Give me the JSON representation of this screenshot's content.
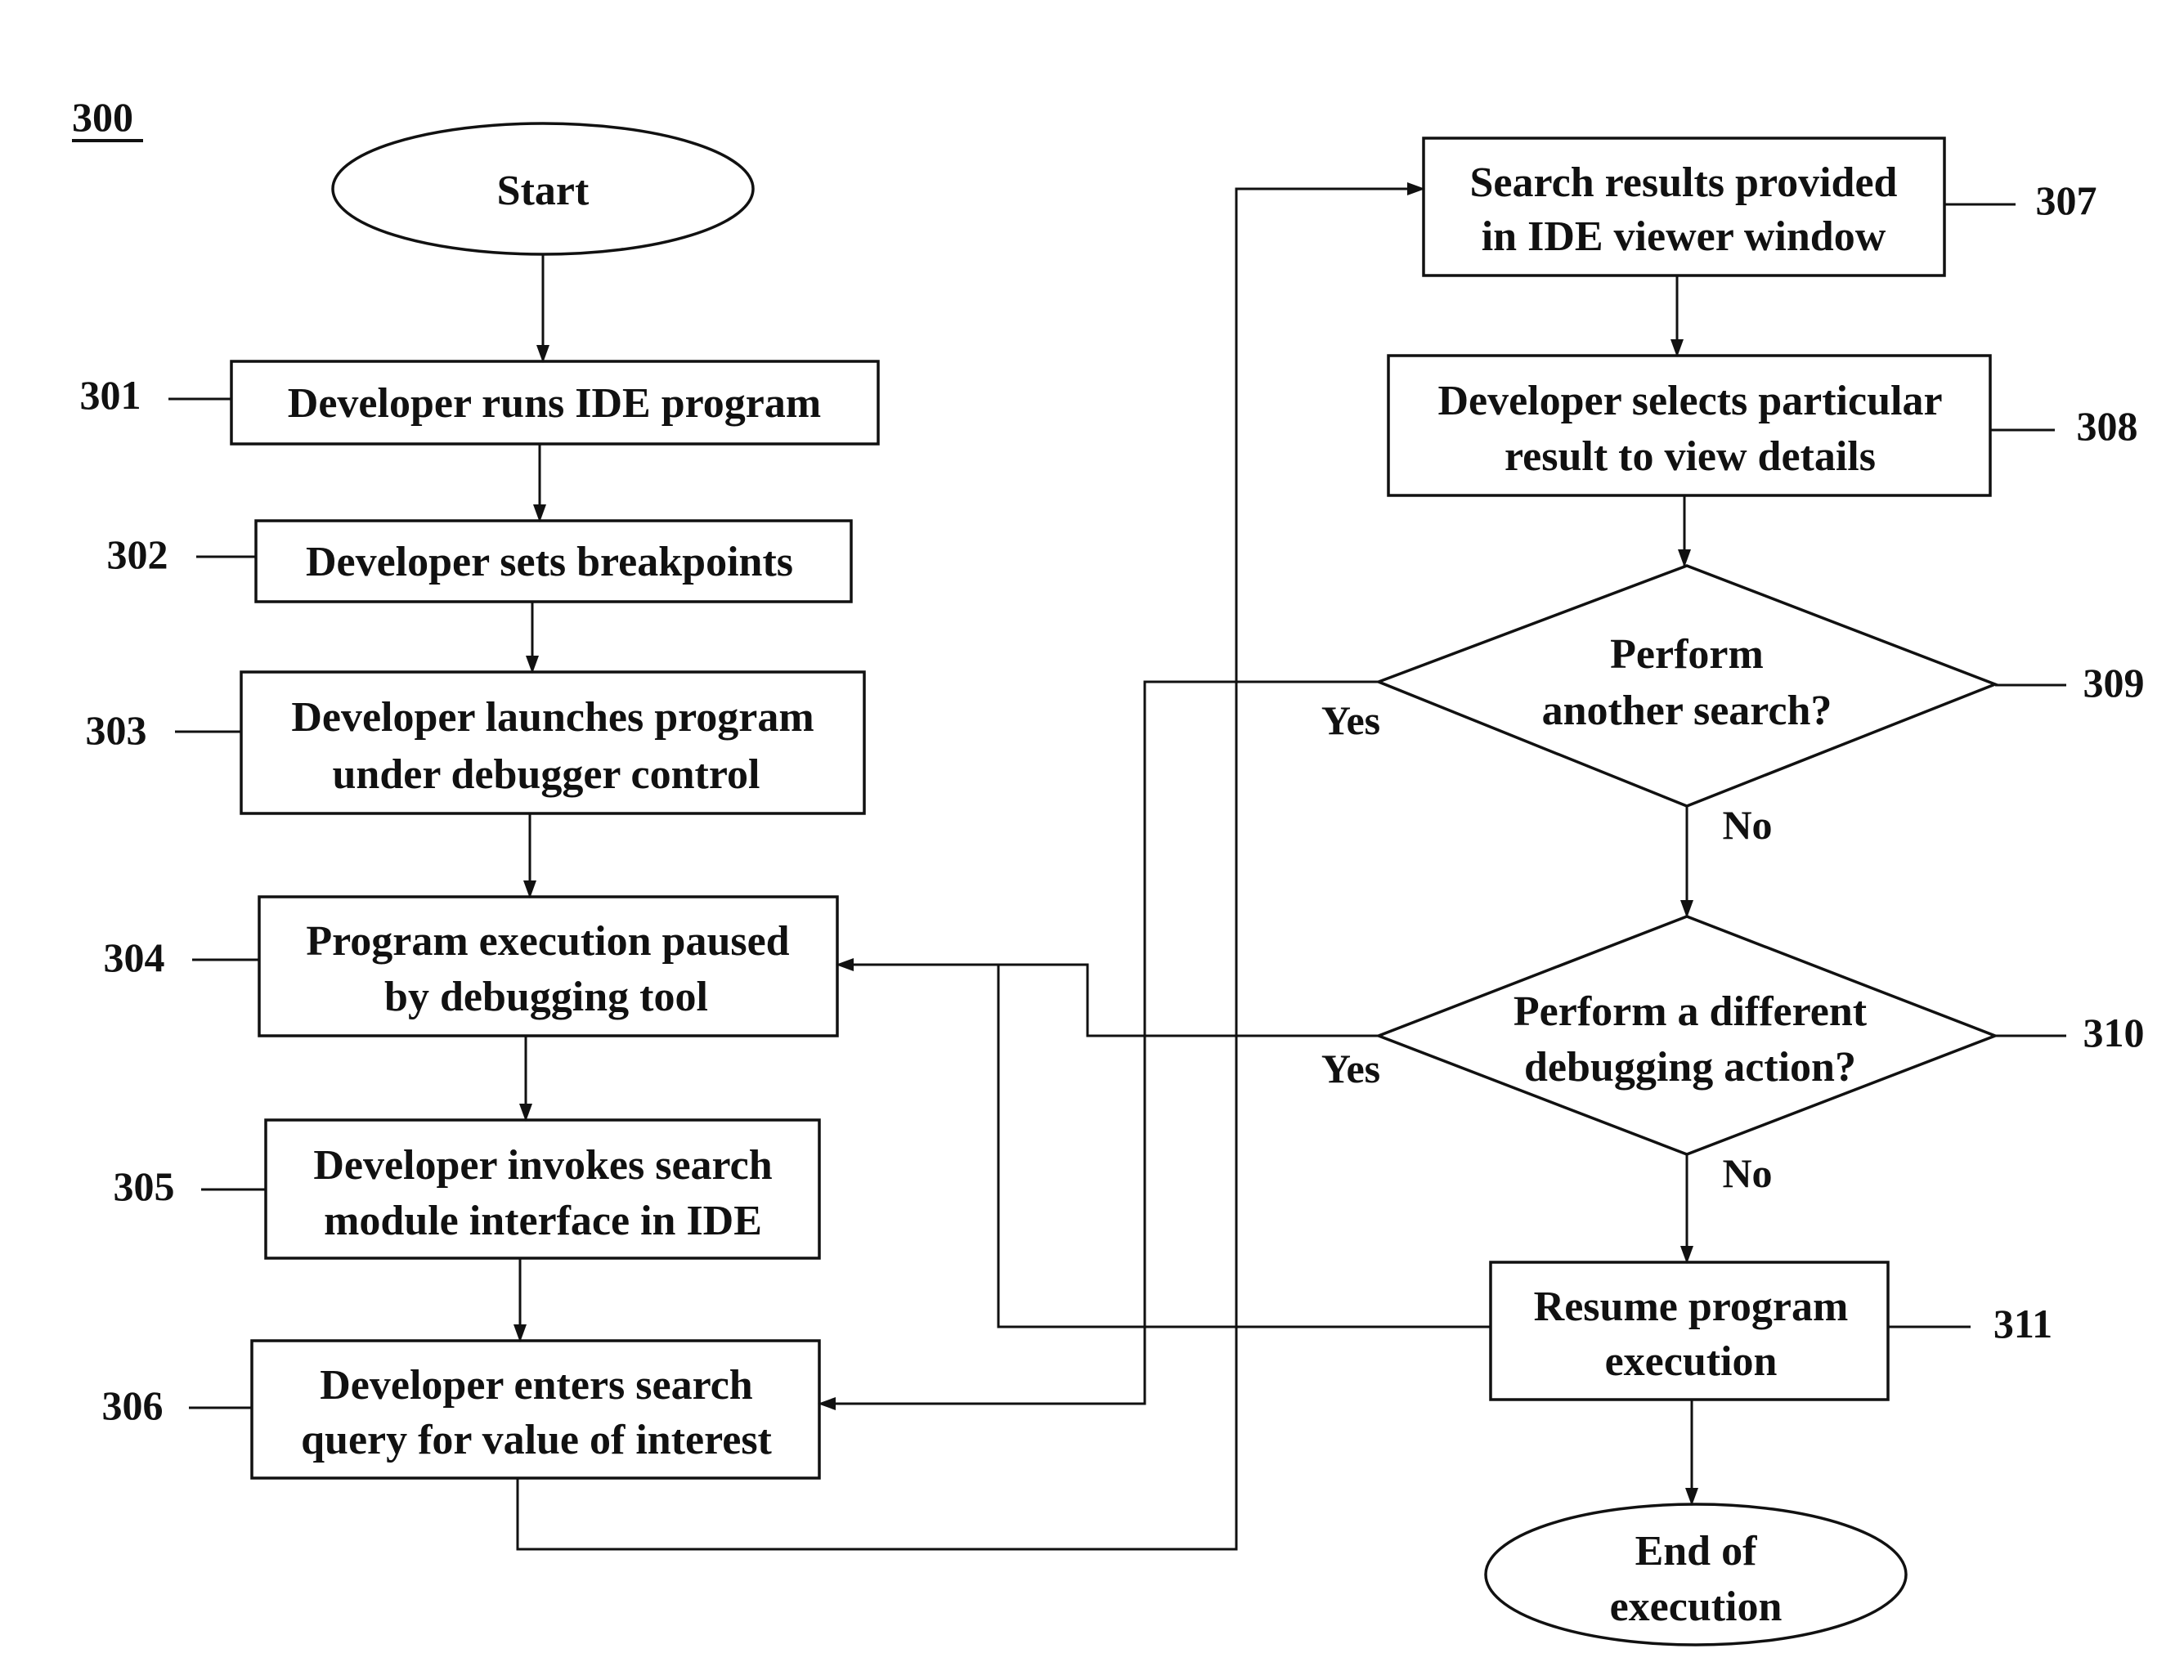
{
  "figure": {
    "number": "300"
  },
  "nodes": {
    "start": {
      "text": [
        "Start"
      ]
    },
    "n301": {
      "ref": "301",
      "text": [
        "Developer runs IDE program"
      ]
    },
    "n302": {
      "ref": "302",
      "text": [
        "Developer sets breakpoints"
      ]
    },
    "n303": {
      "ref": "303",
      "text": [
        "Developer launches program",
        "under debugger control"
      ]
    },
    "n304": {
      "ref": "304",
      "text": [
        "Program execution paused",
        "by debugging tool"
      ]
    },
    "n305": {
      "ref": "305",
      "text": [
        "Developer invokes search",
        "module interface in IDE"
      ]
    },
    "n306": {
      "ref": "306",
      "text": [
        "Developer enters search",
        "query for value of interest"
      ]
    },
    "n307": {
      "ref": "307",
      "text": [
        "Search results provided",
        "in IDE viewer window"
      ]
    },
    "n308": {
      "ref": "308",
      "text": [
        "Developer selects particular",
        "result to view details"
      ]
    },
    "n309": {
      "ref": "309",
      "text": [
        "Perform",
        "another search?"
      ],
      "yes": "Yes",
      "no": "No"
    },
    "n310": {
      "ref": "310",
      "text": [
        "Perform a different",
        "debugging action?"
      ],
      "yes": "Yes",
      "no": "No"
    },
    "n311": {
      "ref": "311",
      "text": [
        "Resume program",
        "execution"
      ]
    },
    "end": {
      "text": [
        "End of",
        "execution"
      ]
    }
  },
  "edges": [
    {
      "from": "start",
      "to": "n301"
    },
    {
      "from": "n301",
      "to": "n302"
    },
    {
      "from": "n302",
      "to": "n303"
    },
    {
      "from": "n303",
      "to": "n304"
    },
    {
      "from": "n304",
      "to": "n305"
    },
    {
      "from": "n305",
      "to": "n306"
    },
    {
      "from": "n306",
      "to": "n307"
    },
    {
      "from": "n307",
      "to": "n308"
    },
    {
      "from": "n308",
      "to": "n309"
    },
    {
      "from": "n309",
      "to": "n306",
      "label": "Yes"
    },
    {
      "from": "n309",
      "to": "n310",
      "label": "No"
    },
    {
      "from": "n310",
      "to": "n304",
      "label": "Yes"
    },
    {
      "from": "n310",
      "to": "n311",
      "label": "No"
    },
    {
      "from": "n311",
      "to": "n304"
    },
    {
      "from": "n311",
      "to": "end"
    }
  ]
}
